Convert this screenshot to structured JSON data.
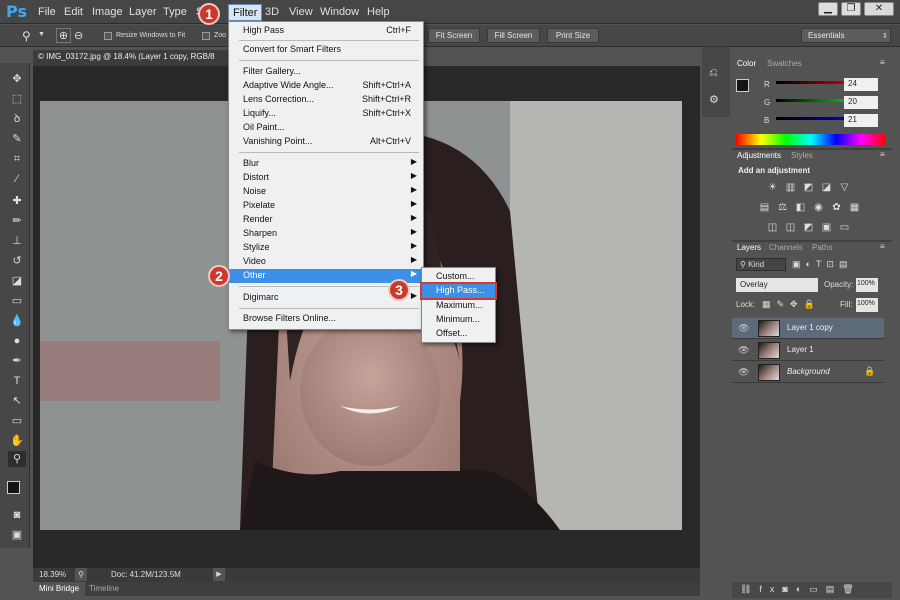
{
  "app": {
    "logo": "Ps"
  },
  "menubar": {
    "items": [
      "File",
      "Edit",
      "Image",
      "Layer",
      "Type",
      "S",
      "Filter",
      "3D",
      "View",
      "Window",
      "Help"
    ]
  },
  "window_controls": {
    "minimize": "▁",
    "restore": "❐",
    "close": "✕"
  },
  "options": {
    "resize_windows": "Resize Windows to Fit",
    "zoom_all": "Zoo",
    "fit_screen": "Fit Screen",
    "fill_screen": "Fill Screen",
    "print_size": "Print Size",
    "workspace": "Essentials"
  },
  "document": {
    "tab_title": "© IMG_03172.jpg @ 18.4% (Layer 1 copy, RGB/8"
  },
  "status": {
    "zoom": "18.39%",
    "doc": "Doc: 41.2M/123.5M"
  },
  "bottom_tabs": {
    "mini_bridge": "Mini Bridge",
    "timeline": "Timeline"
  },
  "filter_menu": {
    "group1": [
      {
        "label": "High Pass",
        "shortcut": "Ctrl+F"
      }
    ],
    "group2": [
      {
        "label": "Convert for Smart Filters",
        "shortcut": ""
      }
    ],
    "group3": [
      {
        "label": "Filter Gallery...",
        "shortcut": ""
      },
      {
        "label": "Adaptive Wide Angle...",
        "shortcut": "Shift+Ctrl+A"
      },
      {
        "label": "Lens Correction...",
        "shortcut": "Shift+Ctrl+R"
      },
      {
        "label": "Liquify...",
        "shortcut": "Shift+Ctrl+X"
      },
      {
        "label": "Oil Paint...",
        "shortcut": ""
      },
      {
        "label": "Vanishing Point...",
        "shortcut": "Alt+Ctrl+V"
      }
    ],
    "group4": [
      "Blur",
      "Distort",
      "Noise",
      "Pixelate",
      "Render",
      "Sharpen",
      "Stylize",
      "Video",
      "Other"
    ],
    "group5": [
      "Digimarc"
    ],
    "group6": [
      "Browse Filters Online..."
    ]
  },
  "other_submenu": [
    "Custom...",
    "High Pass...",
    "Maximum...",
    "Minimum...",
    "Offset..."
  ],
  "badges": [
    "1",
    "2",
    "3"
  ],
  "color_panel": {
    "tab_color": "Color",
    "tab_swatches": "Swatches",
    "r_label": "R",
    "g_label": "G",
    "b_label": "B",
    "r": "24",
    "g": "20",
    "b": "21"
  },
  "adjustments_panel": {
    "tab_adjustments": "Adjustments",
    "tab_styles": "Styles",
    "title": "Add an adjustment"
  },
  "layers_panel": {
    "tab_layers": "Layers",
    "tab_channels": "Channels",
    "tab_paths": "Paths",
    "kind": "Kind",
    "blend": "Overlay",
    "opacity_label": "Opacity:",
    "opacity": "100%",
    "lock_label": "Lock:",
    "fill_label": "Fill:",
    "fill": "100%",
    "layers": [
      "Layer 1 copy",
      "Layer 1",
      "Background"
    ]
  },
  "colors": {
    "accent": "#3fa9f5",
    "highlight": "#3e8fe8",
    "badge": "#c9392c"
  }
}
